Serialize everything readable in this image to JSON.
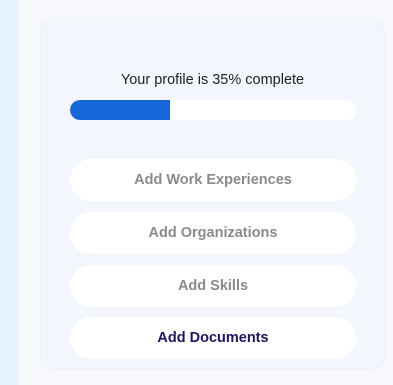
{
  "profile": {
    "title": "Your profile is 35% complete",
    "progress_percent": 35,
    "progress_color": "#1668d8"
  },
  "actions": [
    {
      "label": "Add Work Experiences",
      "state": "muted"
    },
    {
      "label": "Add Organizations",
      "state": "muted"
    },
    {
      "label": "Add Skills",
      "state": "muted"
    },
    {
      "label": "Add Documents",
      "state": "active"
    }
  ],
  "colors": {
    "muted_text": "#8a8a8a",
    "active_text": "#1e1567",
    "card_background": "#f3f6fc",
    "side_panel": "#e4f2ff"
  }
}
